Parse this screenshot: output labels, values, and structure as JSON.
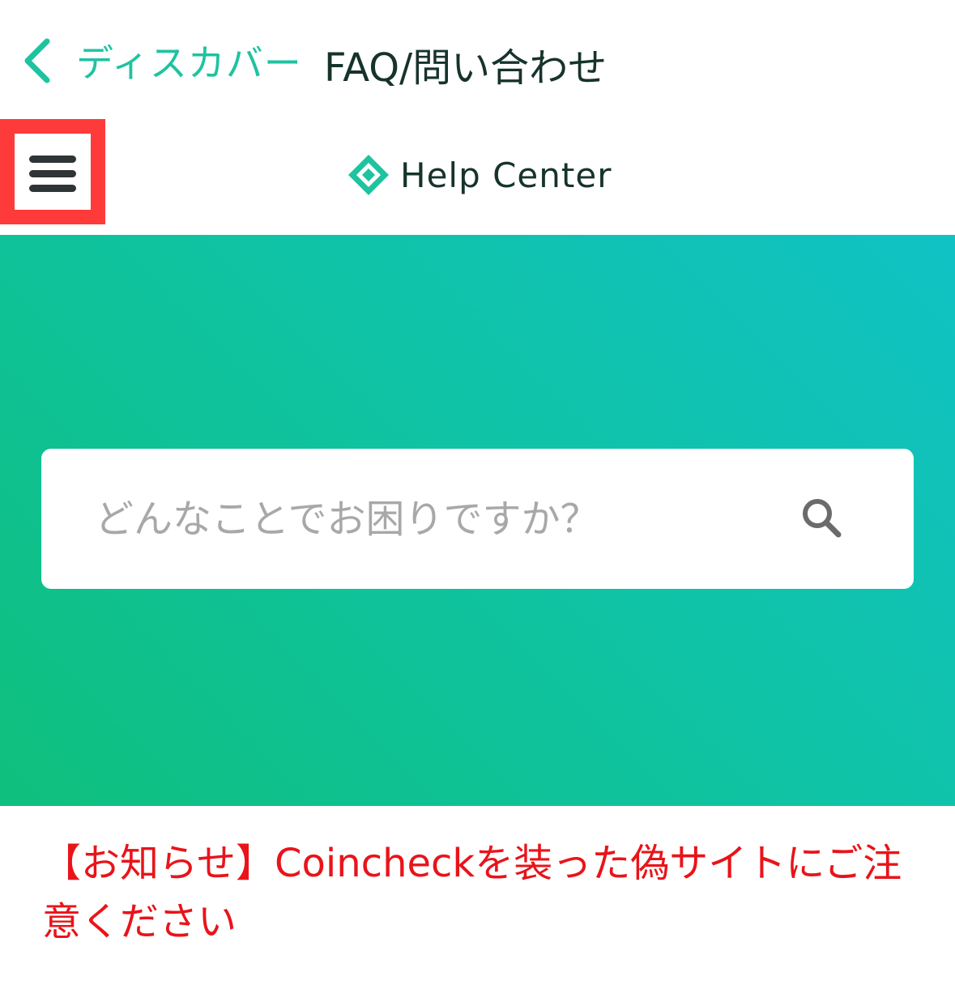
{
  "nav": {
    "back_label": "ディスカバー",
    "title": "FAQ/問い合わせ"
  },
  "header": {
    "logo_text": "Help Center",
    "menu_icon": "hamburger-menu-icon",
    "highlight_color": "#ff3a3a"
  },
  "search": {
    "placeholder": "どんなことでお困りですか？",
    "icon": "search-icon"
  },
  "notice": {
    "text": "【お知らせ】Coincheckを装った偽サイトにご注意ください",
    "color": "#e8141a"
  },
  "colors": {
    "accent": "#1ec3a0",
    "gradient_start": "#0fbf7d",
    "gradient_end": "#10c2c4",
    "title_text": "#16332c"
  }
}
